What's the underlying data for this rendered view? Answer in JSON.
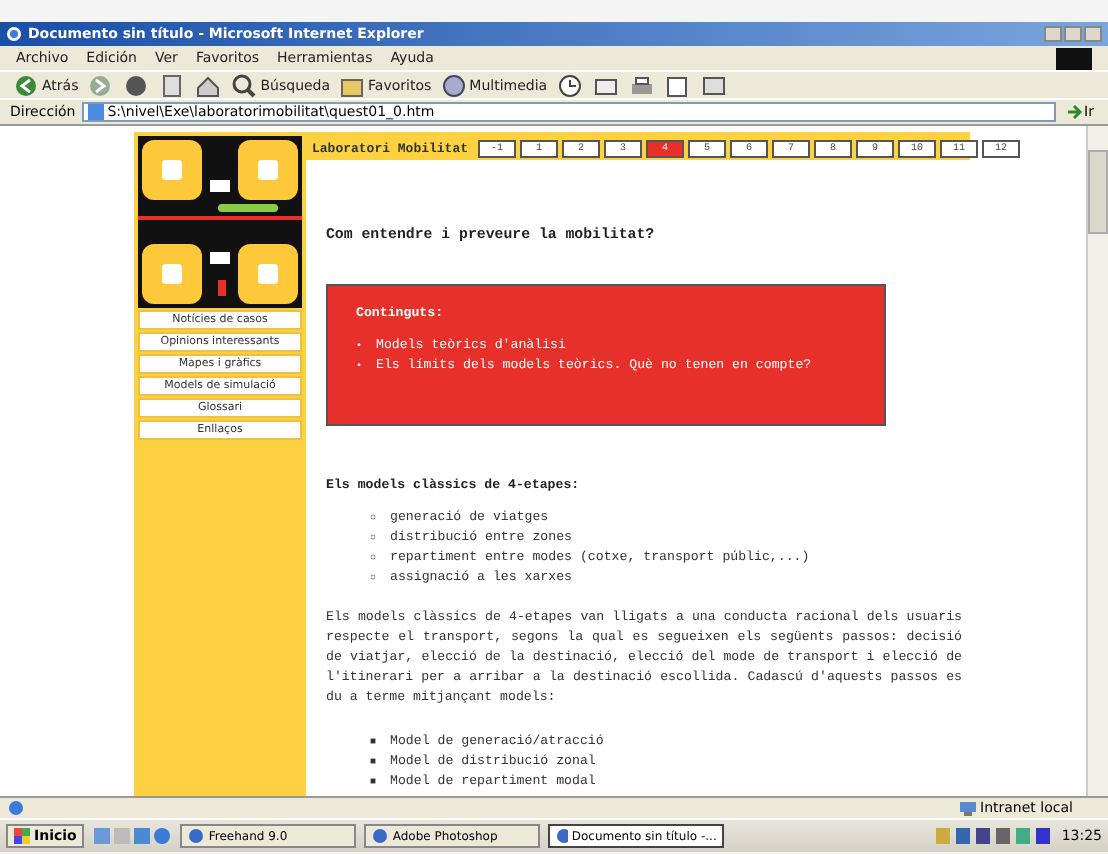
{
  "window": {
    "title": "Documento sin título - Microsoft Internet Explorer"
  },
  "menu": [
    "Archivo",
    "Edición",
    "Ver",
    "Favoritos",
    "Herramientas",
    "Ayuda"
  ],
  "toolbar": [
    {
      "kind": "back",
      "label": "Atrás"
    },
    {
      "kind": "forward"
    },
    {
      "kind": "stop"
    },
    {
      "kind": "refresh"
    },
    {
      "kind": "home"
    },
    {
      "kind": "search",
      "label": "Búsqueda"
    },
    {
      "kind": "favorites",
      "label": "Favoritos"
    },
    {
      "kind": "media",
      "label": "Multimedia"
    },
    {
      "kind": "history"
    },
    {
      "kind": "mail"
    },
    {
      "kind": "print"
    },
    {
      "kind": "edit"
    },
    {
      "kind": "discuss"
    }
  ],
  "address": {
    "label": "Dirección",
    "value": "S:\\nivel\\Exe\\laboratorimobilitat\\quest01_0.htm",
    "go": "Ir"
  },
  "page": {
    "site_title": "Laboratori Mobilitat",
    "pages": [
      {
        "label": "-1",
        "selected": false
      },
      {
        "label": "1",
        "selected": false
      },
      {
        "label": "2",
        "selected": false
      },
      {
        "label": "3",
        "selected": false
      },
      {
        "label": "4",
        "selected": true
      },
      {
        "label": "5",
        "selected": false
      },
      {
        "label": "6",
        "selected": false
      },
      {
        "label": "7",
        "selected": false
      },
      {
        "label": "8",
        "selected": false
      },
      {
        "label": "9",
        "selected": false
      },
      {
        "label": "10",
        "selected": false
      },
      {
        "label": "11",
        "selected": false
      },
      {
        "label": "12",
        "selected": false
      }
    ],
    "sidebar": [
      "Notícies de casos",
      "Opinions interessants",
      "Mapes i gràfics",
      "Models de simulació",
      "Glossari",
      "Enllaços"
    ],
    "heading": "Com entendre i preveure la mobilitat?",
    "contents": {
      "title": "Continguts:",
      "items": [
        {
          "marker": "•",
          "text": "Models teòrics d'anàlisi"
        },
        {
          "marker": "•",
          "text": "Els límits dels models teòrics. Què no tenen en compte?"
        }
      ]
    },
    "subheading": "Els models clàssics de 4-etapes:",
    "stages": [
      {
        "marker": "○",
        "text": "generació de viatges"
      },
      {
        "marker": "○",
        "text": "distribució entre zones"
      },
      {
        "marker": "○",
        "text": "repartiment entre modes (cotxe, transport públic,...)"
      },
      {
        "marker": "○",
        "text": "assignació a les xarxes"
      }
    ],
    "paragraph": "Els models clàssics de 4-etapes van lligats a una conducta racional dels usuaris respecte el transport, segons la qual es segueixen els següents passos: decisió de viatjar, elecció de la destinació, elecció del mode de transport i elecció de l'itinerari per a arribar a la destinació escollida. Cadascú d'aquests passos es du a terme mitjançant models:",
    "models": [
      {
        "marker": "■",
        "text": "Model de generació/atracció"
      },
      {
        "marker": "■",
        "text": "Model de distribució zonal"
      },
      {
        "marker": "■",
        "text": "Model de repartiment modal"
      }
    ]
  },
  "status_bar": {
    "zone": "Intranet local"
  },
  "taskbar": {
    "start": "Inicio",
    "tasks": [
      {
        "label": "Freehand 9.0",
        "selected": false
      },
      {
        "label": "Adobe Photoshop",
        "selected": false
      },
      {
        "label": "Documento sin título -...",
        "selected": true
      }
    ],
    "clock": "13:25"
  }
}
